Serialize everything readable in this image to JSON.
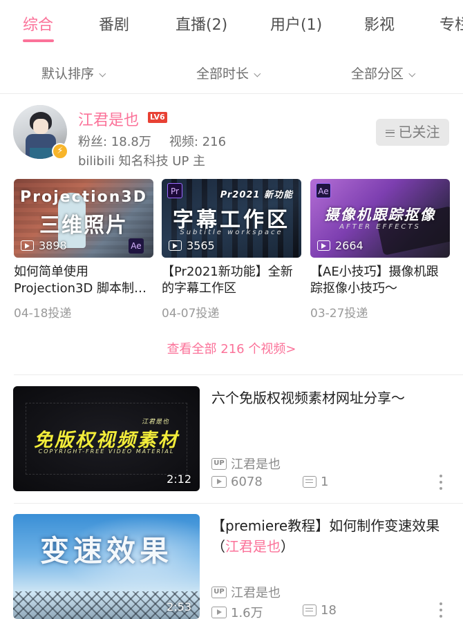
{
  "tabs": [
    {
      "label": "综合",
      "active": true
    },
    {
      "label": "番剧",
      "active": false
    },
    {
      "label": "直播(2)",
      "active": false
    },
    {
      "label": "用户(1)",
      "active": false
    },
    {
      "label": "影视",
      "active": false
    },
    {
      "label": "专栏",
      "active": false
    }
  ],
  "filters": {
    "sort": "默认排序",
    "duration": "全部时长",
    "category": "全部分区"
  },
  "uploader": {
    "name": "江君是也",
    "level": "LV6",
    "fans": "粉丝: 18.8万",
    "videos": "视频: 216",
    "description": "bilibili 知名科技 UP 主",
    "follow_label": "已关注"
  },
  "video_cards": [
    {
      "thumb_text": "Projection3D",
      "thumb_text2": "三维照片",
      "app": "Ae",
      "plays": "3898",
      "title": "如何简单使用Projection3D 脚本制…",
      "date": "04-18投递"
    },
    {
      "thumb_text": "字幕工作区",
      "thumb_sub": "Subtitle workspace",
      "thumb_tag": "Pr2021 新功能",
      "app": "Pr",
      "plays": "3565",
      "title": "【Pr2021新功能】全新的字幕工作区",
      "date": "04-07投递"
    },
    {
      "thumb_text": "摄像机跟踪抠像",
      "thumb_sub": "AFTER EFFECTS",
      "app": "Ae",
      "plays": "2664",
      "title": "【AE小技巧】摄像机跟踪抠像小技巧～",
      "date": "03-27投递"
    }
  ],
  "view_all": "查看全部 216 个视频>",
  "list_items": [
    {
      "thumb_text": "免版权视频素材",
      "thumb_small": "江君是也",
      "thumb_sub": "COPYRIGHT-FREE VIDEO MATERIAL",
      "duration": "2:12",
      "title": "六个免版权视频素材网址分享～",
      "author": "江君是也",
      "plays": "6078",
      "danmaku": "1"
    },
    {
      "thumb_text": "变速效果",
      "duration": "2:53",
      "title_main": "【premiere教程】如何制作变速效果（",
      "title_highlight": "江君是也",
      "title_end": "）",
      "author": "江君是也",
      "plays": "1.6万",
      "danmaku": "18"
    }
  ],
  "colors": {
    "accent": "#fb7299",
    "level_badge": "#e84134",
    "verified": "#f8b52a"
  }
}
